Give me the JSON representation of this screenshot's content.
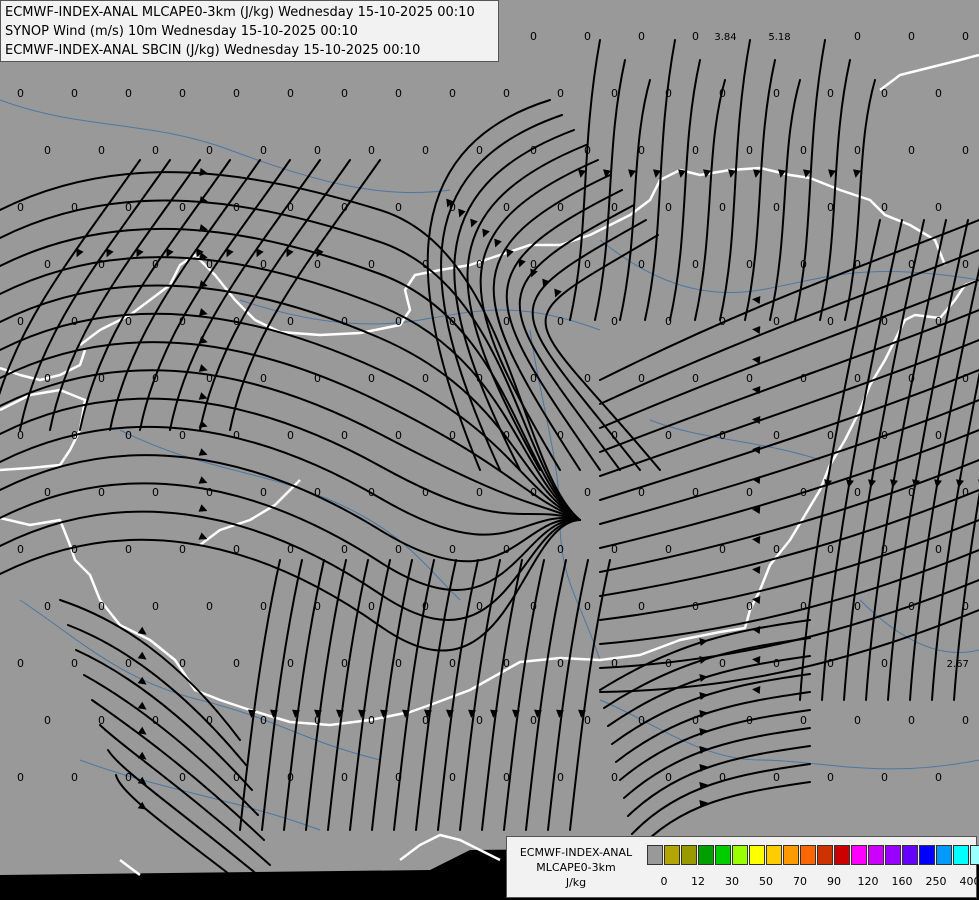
{
  "title_lines": [
    "ECMWF-INDEX-ANAL MLCAPE0-3km (J/kg) Wednesday 15-10-2025 00:10",
    "SYNOP Wind (m/s) 10m Wednesday 15-10-2025 00:10",
    "ECMWF-INDEX-ANAL SBCIN (J/kg) Wednesday 15-10-2025 00:10"
  ],
  "station_values": {
    "zero": "0",
    "special": [
      {
        "label": "3.84",
        "row": 0,
        "col": 12.6
      },
      {
        "label": "5.18",
        "row": 0,
        "col": 13.6
      },
      {
        "label": "2.67",
        "row": 11,
        "col": 16.9
      }
    ]
  },
  "legend": {
    "title_line1": "ECMWF-INDEX-ANAL",
    "title_line2": "MLCAPE0-3km",
    "unit": "J/kg",
    "colors": [
      "#999999",
      "#b3a600",
      "#999900",
      "#00a000",
      "#00cc00",
      "#99ff00",
      "#ffff00",
      "#ffcc00",
      "#ff9900",
      "#ff6600",
      "#cc3300",
      "#cc0000",
      "#ff00ff",
      "#cc00ff",
      "#9900ff",
      "#6600ff",
      "#0000ff",
      "#0099ff",
      "#00ffff",
      "#99ffff",
      "#ffffff"
    ],
    "tick_labels": [
      "0",
      "12",
      "30",
      "50",
      "70",
      "90",
      "120",
      "160",
      "250",
      "400"
    ]
  },
  "colors": {
    "background": "#999999",
    "streamline": "#000000",
    "border": "#ffffff",
    "river": "#3a6ea5"
  }
}
